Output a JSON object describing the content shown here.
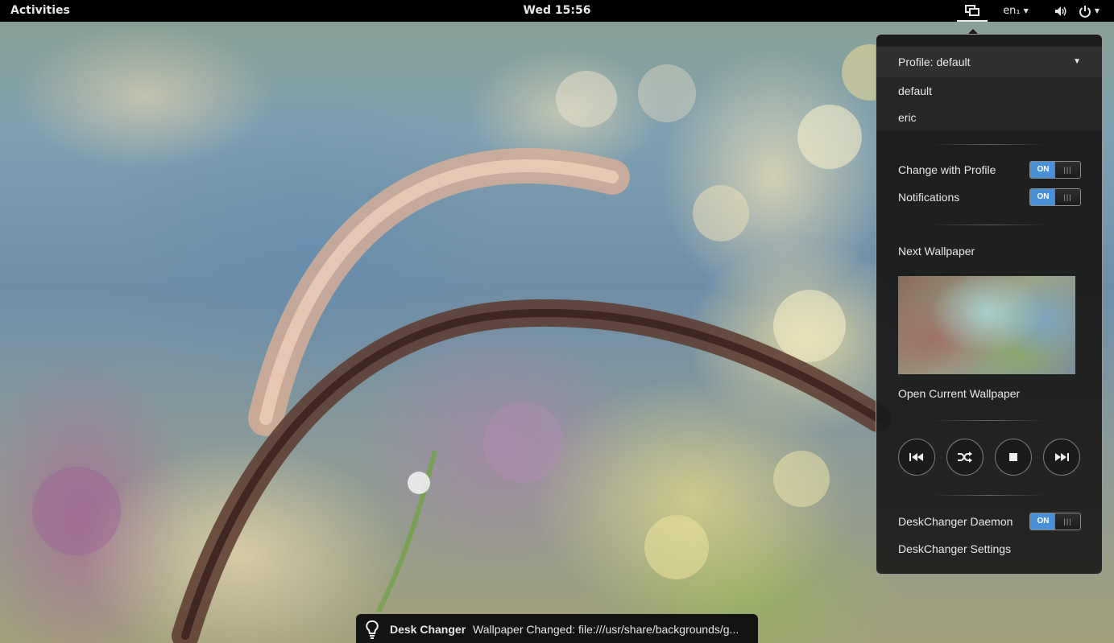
{
  "topbar": {
    "activities": "Activities",
    "clock": "Wed 15:56",
    "keyboard_layout": "en₁",
    "display_icon": "display-icon",
    "volume_icon": "volume-icon",
    "power_icon": "power-icon"
  },
  "popup": {
    "profile_selector": "Profile: default",
    "profiles": [
      "default",
      "eric"
    ],
    "change_with_profile_label": "Change with Profile",
    "change_with_profile_state": "ON",
    "notifications_label": "Notifications",
    "notifications_state": "ON",
    "next_wallpaper_label": "Next Wallpaper",
    "open_current_label": "Open Current Wallpaper",
    "controls": {
      "previous_icon": "previous-track-icon",
      "shuffle_icon": "shuffle-icon",
      "stop_icon": "stop-icon",
      "next_icon": "next-track-icon"
    },
    "daemon_label": "DeskChanger Daemon",
    "daemon_state": "ON",
    "settings_label": "DeskChanger Settings"
  },
  "notification": {
    "icon": "lightbulb-icon",
    "app": "Desk Changer",
    "message": "Wallpaper Changed: file:///usr/share/backgrounds/g..."
  },
  "colors": {
    "toggle_on": "#4a90d9",
    "topbar": "#000000"
  }
}
